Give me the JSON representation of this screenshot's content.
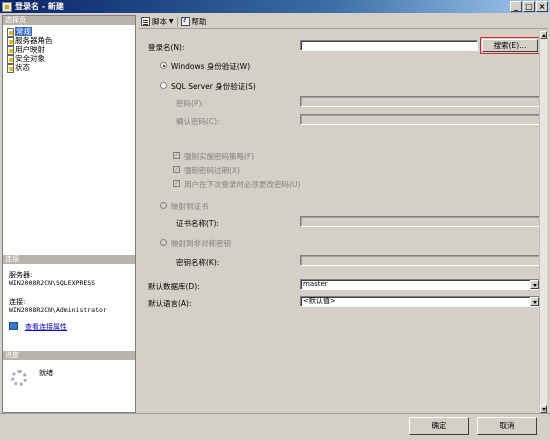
{
  "window": {
    "title": "登录名 - 新建",
    "controls": [
      "_",
      "□",
      "×"
    ]
  },
  "sidebar": {
    "select_page_header": "选择页",
    "pages": [
      {
        "label": "常规",
        "selected": true
      },
      {
        "label": "服务器角色",
        "selected": false
      },
      {
        "label": "用户映射",
        "selected": false
      },
      {
        "label": "安全对象",
        "selected": false
      },
      {
        "label": "状态",
        "selected": false
      }
    ],
    "connection_header": "连接",
    "server_label": "服务器:",
    "server_value": "WIN2008R2CN\\SQLEXPRESS",
    "connection_label": "连接:",
    "connection_value": "WIN2008R2CN\\Administrator",
    "view_connection_link": "查看连接属性",
    "progress_header": "进度",
    "progress_status": "就绪"
  },
  "toolbar": {
    "script_label": "脚本",
    "help_label": "帮助"
  },
  "form": {
    "login_name_label": "登录名(N):",
    "login_name_value": "",
    "search_button": "搜索(E)...",
    "windows_auth_label": "Windows 身份验证(W)",
    "sql_auth_label": "SQL Server 身份验证(S)",
    "password_label": "密码(P):",
    "confirm_password_label": "确认密码(C):",
    "enforce_policy_label": "强制实施密码策略(F)",
    "enforce_expiration_label": "强制密码过期(X)",
    "must_change_label": "用户在下次登录时必须更改密码(U)",
    "cert_map_label": "映射到证书",
    "cert_name_label": "证书名称(T):",
    "asym_key_label": "映射到非对称密钥",
    "key_name_label": "密钥名称(K):",
    "default_db_label": "默认数据库(D):",
    "default_db_value": "master",
    "default_lang_label": "默认语言(A):",
    "default_lang_value": "<默认值>"
  },
  "buttons": {
    "ok": "确定",
    "cancel": "取消"
  },
  "colors": {
    "title_gradient_start": "#0a246a",
    "selection": "#316ac5",
    "search_highlight": "#cc2a2a"
  }
}
